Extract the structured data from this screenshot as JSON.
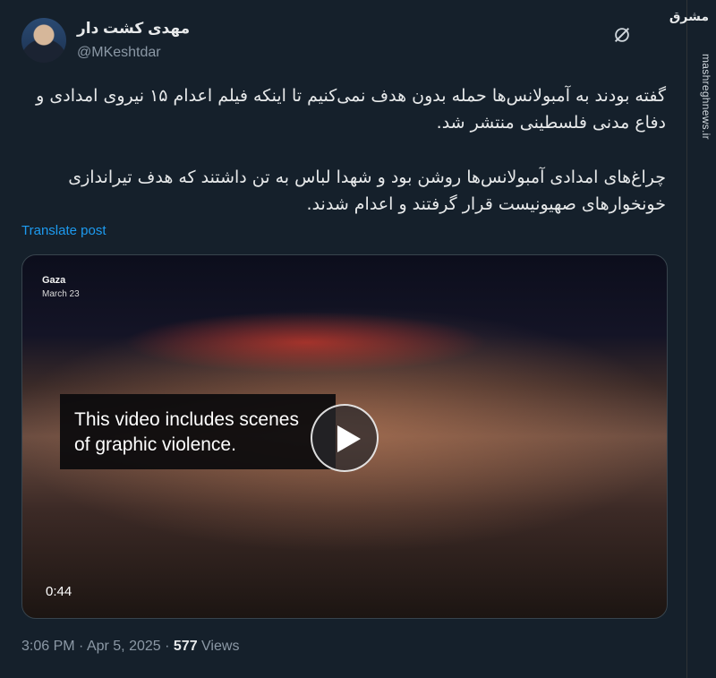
{
  "author": {
    "name": "مهدی کشت دار",
    "handle": "@MKeshtdar"
  },
  "post": {
    "paragraph1": "گفته بودند به آمبولانس‌ها حمله بدون هدف نمی‌کنیم تا اینکه فیلم اعدام ۱۵ نیروی امدادی و دفاع مدنی فلسطینی منتشر شد.",
    "paragraph2": "چراغ‌های امدادی آمبولانس‌ها روشن بود و شهدا لباس به تن داشتند که هدف تیراندازی خونخوارهای صهیونیست قرار گرفتند و اعدام شدند.",
    "translate_label": "Translate post"
  },
  "video": {
    "location": "Gaza",
    "date": "March 23",
    "warning_line1": "This video includes scenes",
    "warning_line2": "of graphic violence.",
    "duration": "0:44"
  },
  "meta": {
    "time": "3:06 PM",
    "date": "Apr 5, 2025",
    "views_count": "577",
    "views_label": "Views"
  },
  "watermark": {
    "logo": "مشرق",
    "site": "mashreghnews.ir"
  },
  "icons": [
    "grok-icon",
    "play-icon"
  ],
  "colors": {
    "background": "#15202b",
    "link": "#1d9bf0",
    "secondary_text": "#8b98a5"
  }
}
